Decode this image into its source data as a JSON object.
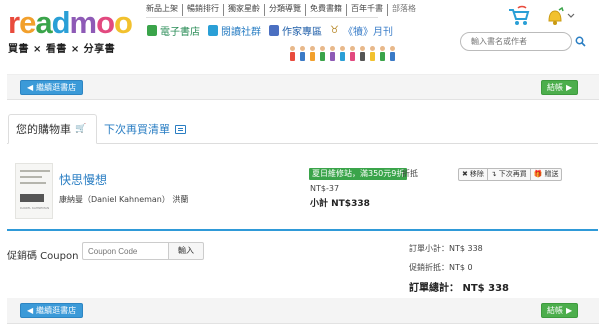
{
  "header": {
    "logo_text": "readmoo",
    "tagline": "買書 × 看書 × 分享書",
    "top_nav": [
      "新品上架",
      "暢銷排行",
      "獨家星齡",
      "分類導覽",
      "免費書籍",
      "百年千書",
      "部落格"
    ],
    "categories": [
      {
        "icon": "ebook-store-icon",
        "label": "電子書店"
      },
      {
        "icon": "reading-community-icon",
        "label": "閱讀社群"
      },
      {
        "icon": "author-zone-icon",
        "label": "作家專區"
      },
      {
        "icon": "ox-icon",
        "label": "《犢》月刊"
      }
    ],
    "search_placeholder": "輸入書名或作者"
  },
  "buttons": {
    "continue_shopping": "繼續逛書店",
    "checkout": "結帳"
  },
  "tabs": {
    "cart": "您的購物車",
    "later": "下次再買清單"
  },
  "item": {
    "title": "快思慢想",
    "authors": "康納曼（Daniel Kahneman） 洪蘭",
    "promo_badge": "夏日維修站，滿350元9折",
    "discount_label": "折抵",
    "discount_value": "NT$-37",
    "subtotal": "小計 NT$338",
    "actions": [
      "移除",
      "下次再買",
      "贈送"
    ]
  },
  "coupon": {
    "label": "促銷碼 Coupon",
    "placeholder": "Coupon Code",
    "button": "輸入"
  },
  "summary": {
    "subtotal": "訂單小計：NT$ 338",
    "discount": "促銷折抵：NT$ 0",
    "total": "訂單總計： NT$ 338"
  },
  "colors": {
    "primary_blue": "#3b9ad8",
    "checkout_green": "#4cae4c",
    "link_blue": "#2a7ec3",
    "promo_green": "#3aa44a"
  }
}
